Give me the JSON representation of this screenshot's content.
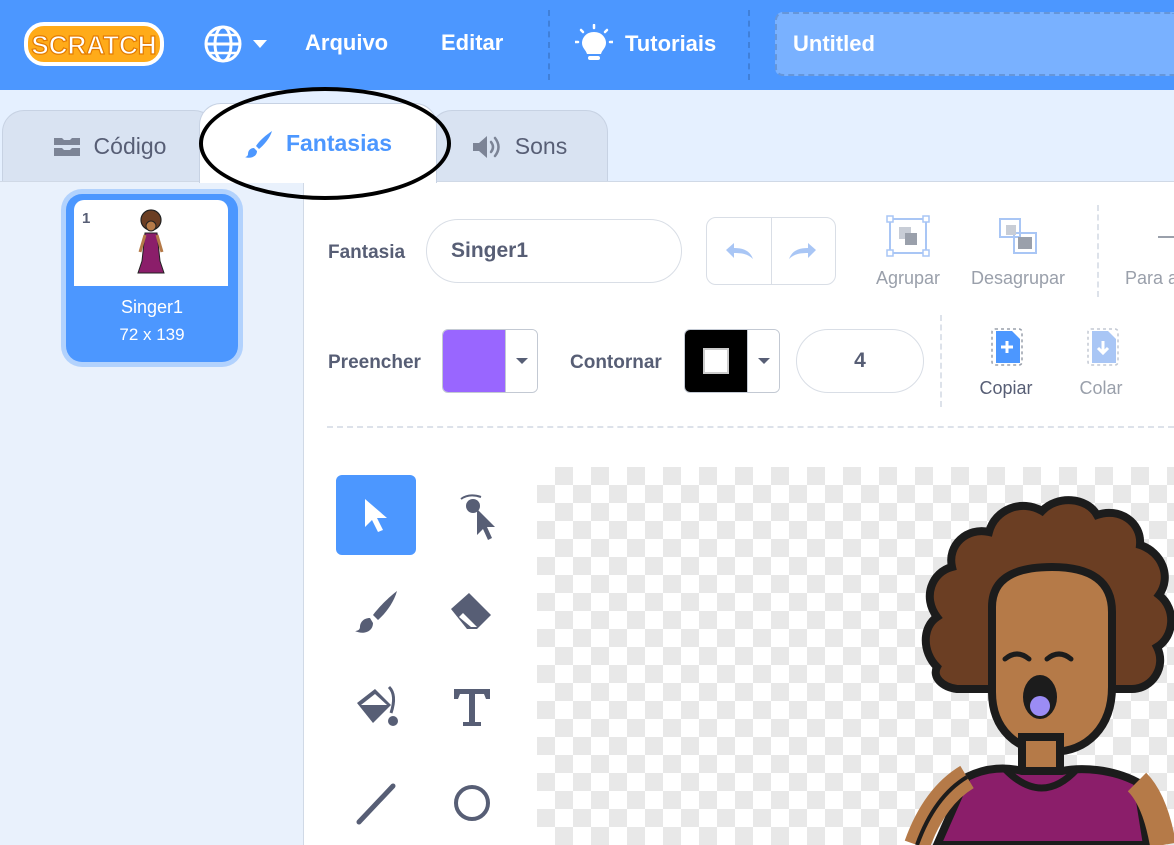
{
  "menubar": {
    "logo_text": "SCRATCH",
    "file_label": "Arquivo",
    "edit_label": "Editar",
    "tutorials_label": "Tutoriais",
    "project_title": "Untitled"
  },
  "tabs": [
    {
      "label": "Código",
      "icon": "code-blocks-icon",
      "active": false
    },
    {
      "label": "Fantasias",
      "icon": "paintbrush-icon",
      "active": true
    },
    {
      "label": "Sons",
      "icon": "speaker-icon",
      "active": false
    }
  ],
  "costumes": [
    {
      "number": "1",
      "name": "Singer1",
      "size": "72 x 139",
      "selected": true
    }
  ],
  "editor": {
    "costume_label": "Fantasia",
    "costume_name": "Singer1",
    "group_label": "Agrupar",
    "ungroup_label": "Desagrupar",
    "forward_label": "Para a",
    "fill_label": "Preencher",
    "outline_label": "Contornar",
    "outline_width": "4",
    "copy_label": "Copiar",
    "paste_label": "Colar"
  },
  "colors": {
    "menubar": "#4c97ff",
    "fill_color": "#9966ff",
    "outline_color": "#000000",
    "accent": "#4c97ff"
  },
  "tools": [
    "select-tool",
    "reshape-tool",
    "brush-tool",
    "eraser-tool",
    "fill-tool",
    "text-tool",
    "line-tool",
    "circle-tool"
  ],
  "selected_tool": "select-tool"
}
